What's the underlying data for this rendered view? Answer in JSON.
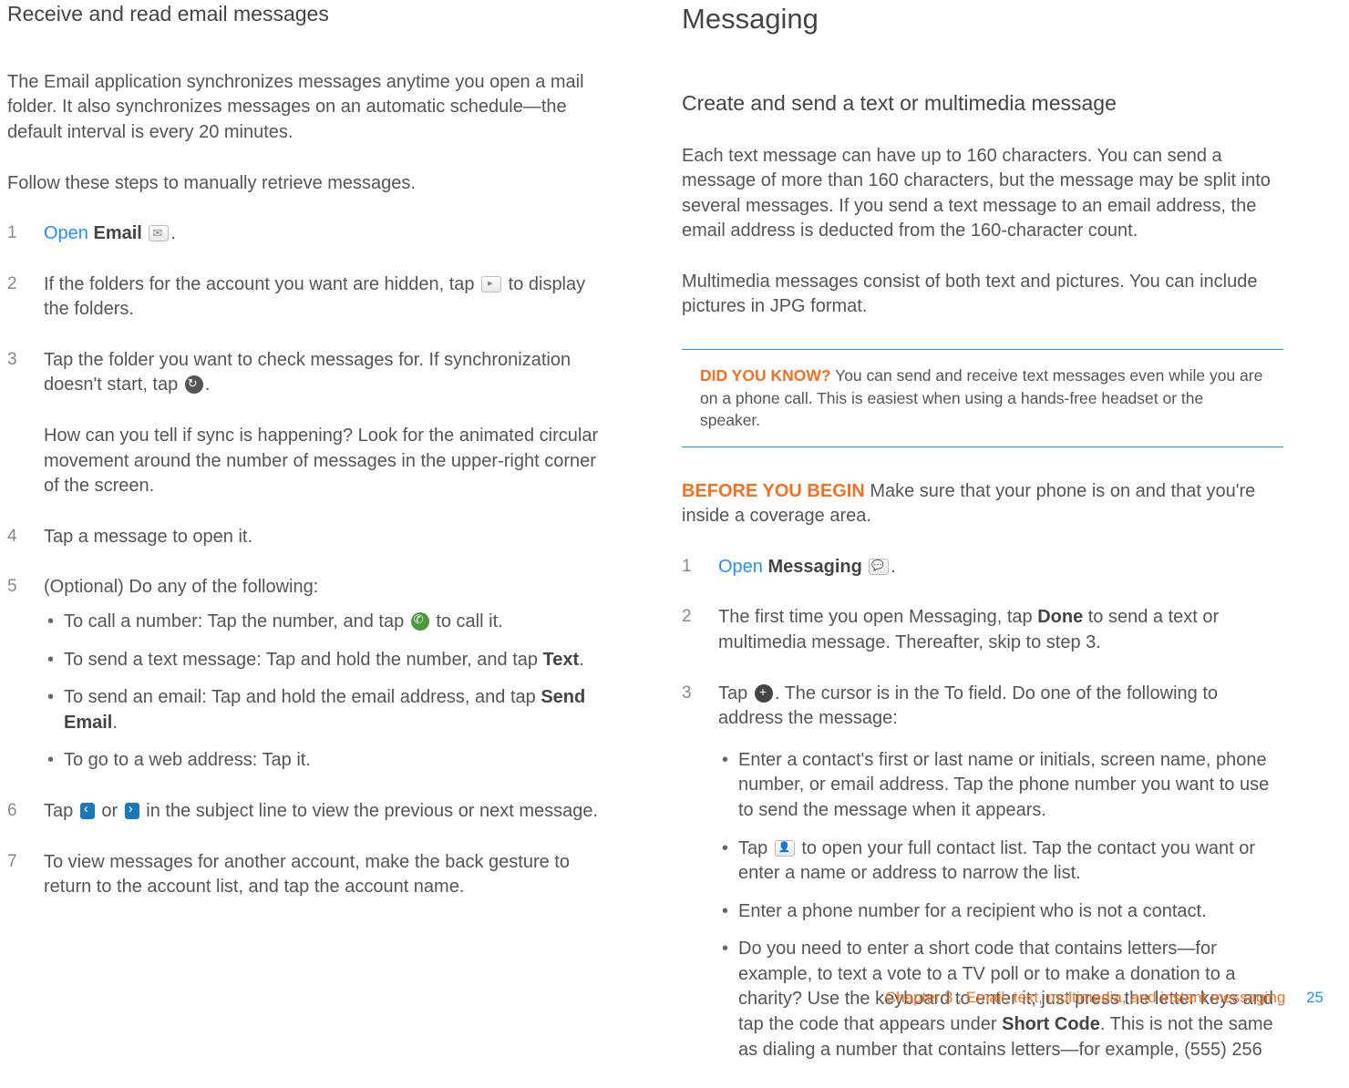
{
  "left": {
    "title": "Receive and read email messages",
    "intro": "The Email application synchronizes messages anytime you open a mail folder. It also synchronizes messages on an automatic schedule—the default interval is every 20 minutes.",
    "leadIn": "Follow these steps to manually retrieve messages.",
    "s1_open": "Open",
    "s1_app": "Email",
    "s1_dot": ".",
    "s2a": "If the folders for the account you want are hidden, tap ",
    "s2b": " to display the folders.",
    "s3a": "Tap the folder you want to check messages for. If synchronization doesn't start, tap ",
    "s3b": ".",
    "s3sub": "How can you tell if sync is happening? Look for the animated circular movement around the number of messages in the upper-right corner of the screen.",
    "s4": "Tap a message to open it.",
    "s5": "(Optional) Do any of the following:",
    "s5b1a": "To call a number: Tap the number, and tap ",
    "s5b1b": " to call it.",
    "s5b2a": "To send a text message: Tap and hold the number, and tap ",
    "s5b2b": "Text",
    "s5b2c": ".",
    "s5b3a": "To send an email: Tap and hold the email address, and tap ",
    "s5b3b": "Send Email",
    "s5b3c": ".",
    "s5b4": "To go to a web address: Tap it.",
    "s6a": "Tap ",
    "s6b": " or ",
    "s6c": " in the subject line to view the previous or next message.",
    "s7": "To view messages for another account, make the back gesture to return to the account list, and tap the account name."
  },
  "right": {
    "title": "Messaging",
    "subtitle": "Create and send a text or multimedia message",
    "p1": "Each text message can have up to 160 characters. You can send a message of more than 160 characters, but the message may be split into several messages. If you send a text message to an email address, the email address is deducted from the 160-character count.",
    "p2": "Multimedia messages consist of both text and pictures. You can include pictures in JPG format.",
    "tipLabel": "DID YOU KNOW?",
    "tipBody": " You can send and receive text messages even while you are on a phone call. This is easiest when using a hands-free headset or the speaker.",
    "beforeLabel": "BEFORE YOU BEGIN",
    "beforeBody": " Make sure that your phone is on and that you're inside a coverage area.",
    "s1_open": "Open",
    "s1_app": "Messaging",
    "s1_dot": ".",
    "s2a": "The first time you open Messaging, tap ",
    "s2b": "Done",
    "s2c": " to send a text or multimedia message. Thereafter, skip to step 3.",
    "s3a": "Tap ",
    "s3b": ". The cursor is in the To field. Do one of the following to address the message:",
    "s3b1": "Enter a contact's first or last name or initials, screen name, phone number, or email address. Tap the phone number you want to use to send the message when it appears.",
    "s3b2a": "Tap ",
    "s3b2b": " to open your full contact list. Tap the contact you want or enter a name or address to narrow the list.",
    "s3b3": "Enter a phone number for a recipient who is not a contact.",
    "s3b4a": "Do you need to enter a short code that contains letters—for example, to text a vote to a TV poll or to make a donation to a charity? Use the keyboard to enter it; just press the letter keys and tap the code that appears under ",
    "s3b4b": "Short Code",
    "s3b4c": ". This is not the same as dialing a number that contains letters—for example, (555) 256"
  },
  "footer": {
    "chapter": "Chapter 3 : Email, text, multimedia, and instant messaging",
    "page": "25"
  }
}
